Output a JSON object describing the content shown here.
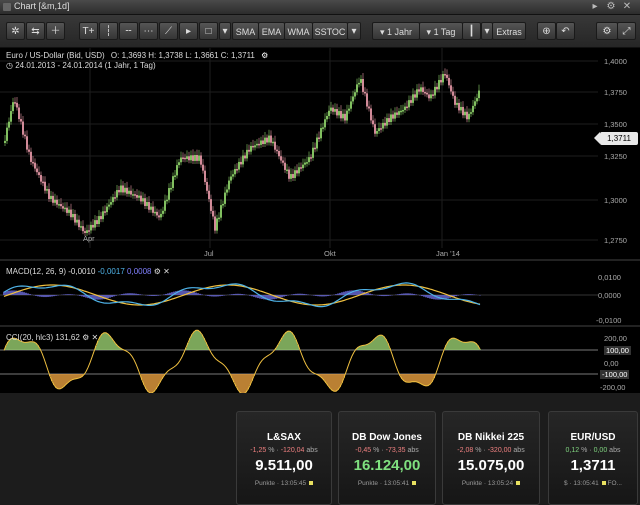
{
  "window": {
    "title": "Chart [&m,1d]"
  },
  "toolbar": {
    "sma": "SMA",
    "ema": "EMA",
    "wma": "WMA",
    "sstoc": "SSTOC",
    "period": "1 Jahr",
    "interval": "1 Tag",
    "extras": "Extras",
    "text_tool": "T+"
  },
  "chart": {
    "instrument": "Euro / US-Dollar (Bid, USD)",
    "ohlc": "O: 1,3693  H: 1,3738  L: 1,3661  C: 1,3711",
    "range": "24.01.2013 - 24.01.2014 (1 Jahr, 1 Tag)",
    "current_price": "1,3711",
    "price_ticks": [
      "1,4000",
      "1,3750",
      "1,3500",
      "1,3250",
      "1,3000",
      "1,2750"
    ],
    "time_ticks": [
      "Apr",
      "Jul",
      "Okt",
      "Jan '14"
    ],
    "colors": {
      "up": "#8fd46a",
      "down": "#e89aa8"
    }
  },
  "macd": {
    "label": "MACD(12, 26, 9)",
    "v1": "-0,0010",
    "v2": "-0,0017",
    "v3": "0,0008",
    "ticks": [
      "0,0100",
      "0,0000",
      "-0,0100"
    ],
    "colors": {
      "macd": "#4fb3e8",
      "signal": "#f0c040",
      "hist": "#6a6ad8"
    }
  },
  "cci": {
    "label": "CCI(20, hlc3)",
    "value": "131,62",
    "ticks": [
      "200,00",
      "100,00",
      "0,00",
      "-100,00",
      "-200,00"
    ],
    "colors": {
      "line": "#f0c040"
    }
  },
  "cards": [
    {
      "name": "L&SAX",
      "pct": "-1,25",
      "abs": "-120,04",
      "value": "9.511,00",
      "trend": "down",
      "unit": "Punkte",
      "time": "13:05:45"
    },
    {
      "name": "DB Dow Jones",
      "pct": "-0,45",
      "abs": "-73,35",
      "value": "16.124,00",
      "trend": "up",
      "unit": "Punkte",
      "time": "13:05:41"
    },
    {
      "name": "DB Nikkei 225",
      "pct": "-2,08",
      "abs": "-320,00",
      "value": "15.075,00",
      "trend": "down",
      "unit": "Punkte",
      "time": "13:05:24"
    },
    {
      "name": "EUR/USD",
      "pct": "0,12",
      "abs": "0,00",
      "value": "1,3711",
      "trend": "none",
      "unit": "$",
      "time": "13:05:41",
      "extra": "FO..."
    }
  ],
  "labels": {
    "pct": "%",
    "abs": "abs",
    "sep": "·"
  }
}
